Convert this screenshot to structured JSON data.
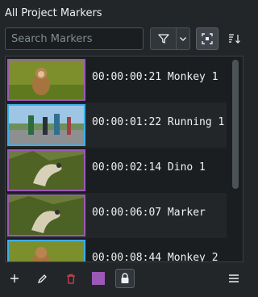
{
  "header": {
    "title": "All Project Markers"
  },
  "search": {
    "placeholder": "Search Markers",
    "value": ""
  },
  "toolbar": {
    "filter_icon": "funnel-icon",
    "dropdown_icon": "chevron-down-icon",
    "zoom_icon": "fit-zoom-icon",
    "sort_icon": "sort-icon"
  },
  "markers": [
    {
      "label": "00:00:00:21 Monkey 1",
      "border_color": "#9b59b6"
    },
    {
      "label": "00:00:01:22 Running 1",
      "border_color": "#3daee9"
    },
    {
      "label": "00:00:02:14 Dino 1",
      "border_color": "#9b59b6"
    },
    {
      "label": "00:00:06:07 Marker",
      "border_color": "#9b59b6"
    },
    {
      "label": "00:00:08:44 Monkey 2",
      "border_color": "#3daee9"
    }
  ],
  "bottom": {
    "color_swatch": "#9b59b6",
    "icons": [
      "plus-icon",
      "pencil-icon",
      "trash-icon",
      "color-swatch",
      "lock-icon",
      "hamburger-menu-icon"
    ]
  }
}
